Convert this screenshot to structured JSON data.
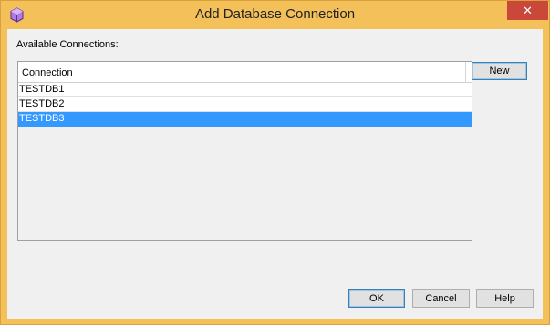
{
  "window": {
    "title": "Add Database Connection",
    "close_glyph": "✕",
    "icon": "cube-icon"
  },
  "dialog": {
    "available_label": "Available Connections:",
    "table": {
      "header": "Connection",
      "rows": [
        "TESTDB1",
        "TESTDB2",
        "TESTDB3"
      ],
      "selected_index": 2
    },
    "buttons": {
      "new": "New",
      "ok": "OK",
      "cancel": "Cancel",
      "help": "Help"
    }
  },
  "colors": {
    "frame": "#f4c05a",
    "close": "#c9483a",
    "selection": "#3399ff"
  }
}
